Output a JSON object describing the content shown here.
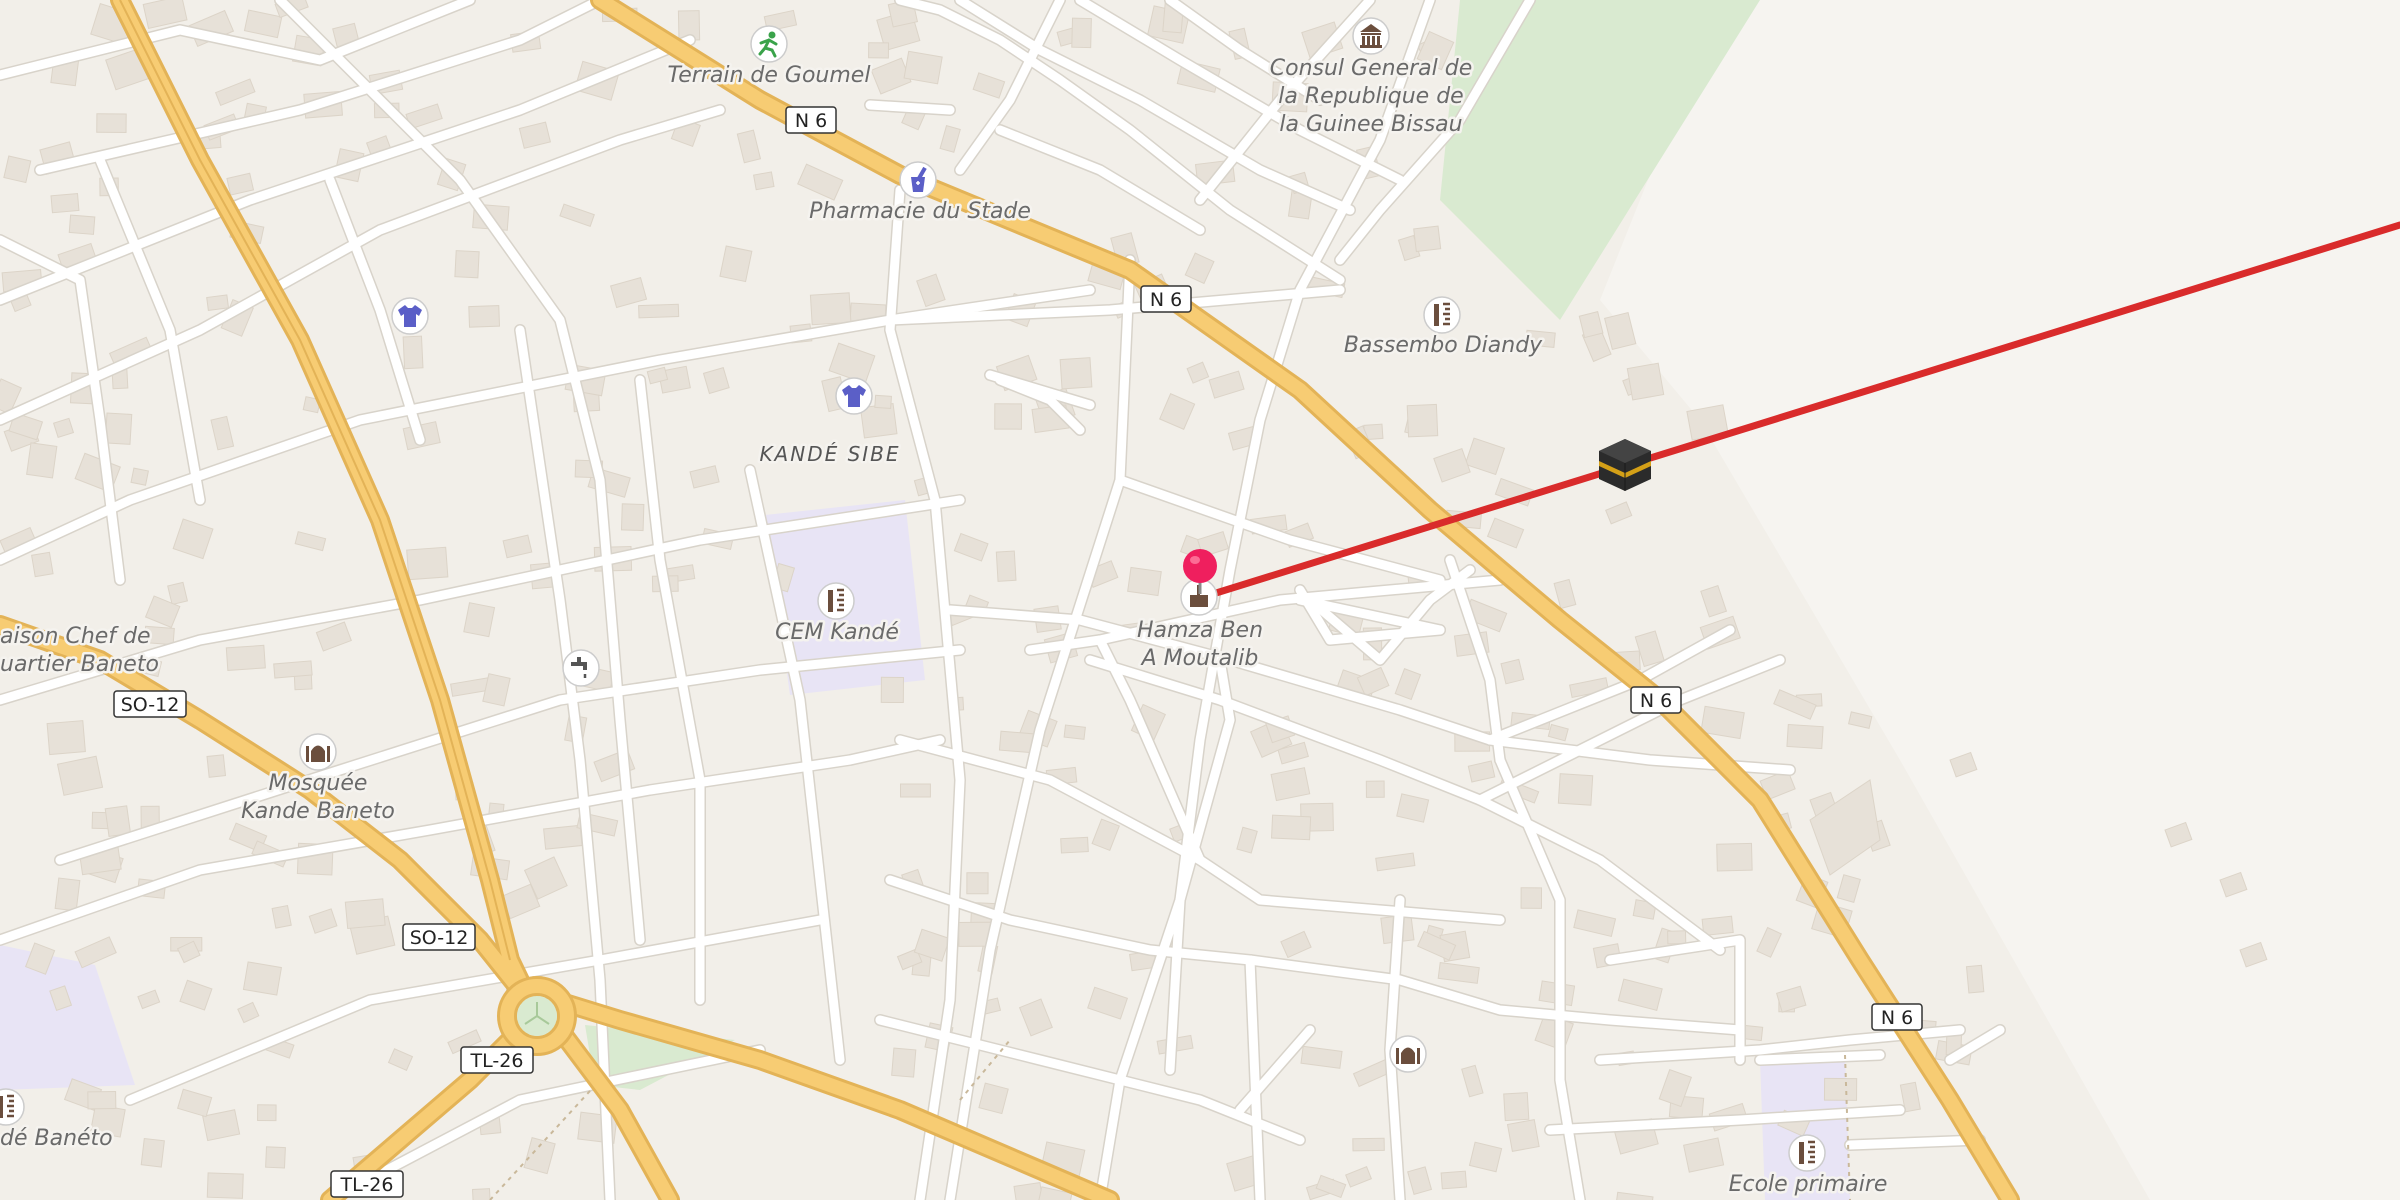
{
  "map": {
    "place_labels": {
      "terrain_goumel": "Terrain de Goumel",
      "pharmacie": "Pharmacie du Stade",
      "consul_1": "Consul General de",
      "consul_2": "la Republique de",
      "consul_3": "la Guinee Bissau",
      "bassembo": "Bassembo Diandy",
      "kande_sibe": "KANDÉ SIBE",
      "cem_kande": "CEM Kandé",
      "hamza_1": "Hamza Ben",
      "hamza_2": "A Moutalib",
      "maison_1": "aison Chef de",
      "maison_2": "uartier Baneto",
      "mosquee_1": "Mosquée",
      "mosquee_2": "Kande Baneto",
      "kande_baneto": "dé Banéto",
      "ecole": "Ecole primaire"
    },
    "route_shields": {
      "n6_a": "N 6",
      "n6_b": "N 6",
      "n6_c": "N 6",
      "n6_d": "N 6",
      "so12_a": "SO-12",
      "so12_b": "SO-12",
      "tl26_a": "TL-26",
      "tl26_b": "TL-26"
    },
    "icons": {
      "pitch": "sports-pitch-icon",
      "pharmacy": "pharmacy-icon",
      "embassy": "embassy-icon",
      "school": "school-icon",
      "clothes": "clothes-shop-icon",
      "mosque": "mosque-icon",
      "tap": "water-tap-icon",
      "pin": "location-pin-icon",
      "kaaba": "kaaba-icon"
    },
    "colors": {
      "background": "#f2efe9",
      "minor_road": "#ffffff",
      "major_road": "#f7cc73",
      "road_casing": "#e3b357",
      "building": "#e7e1d8",
      "school_area": "#e8e4f5",
      "park": "#d9ead0",
      "qibla_line": "#d92b2b",
      "pin": "#ef1f5e",
      "poi_icon": "#5a4a3a",
      "shop_icon": "#5b5fc7",
      "label": "#6a6a6a"
    }
  }
}
